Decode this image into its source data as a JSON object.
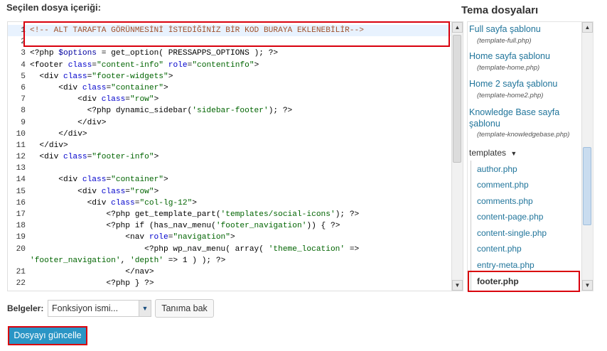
{
  "editor": {
    "heading": "Seçilen dosya içeriği:",
    "lines": [
      {
        "n": "1",
        "html": "<span class=\"cm\">&lt;!-- ALT TARAFTA GÖRÜNMESİNİ İSTEDİĞİNİZ BİR KOD BURAYA EKLENEBİLİR--&gt;</span>"
      },
      {
        "n": "2",
        "html": ""
      },
      {
        "n": "3",
        "html": "&lt;?php <span class=\"var\">$options</span> = get_option( PRESSAPPS_OPTIONS ); ?&gt;"
      },
      {
        "n": "4",
        "html": "&lt;footer <span class=\"at\">class</span>=<span class=\"st\">\"content-info\"</span> <span class=\"at\">role</span>=<span class=\"st\">\"contentinfo\"</span>&gt;"
      },
      {
        "n": "5",
        "html": "  &lt;div <span class=\"at\">class</span>=<span class=\"st\">\"footer-widgets\"</span>&gt;"
      },
      {
        "n": "6",
        "html": "      &lt;div <span class=\"at\">class</span>=<span class=\"st\">\"container\"</span>&gt;"
      },
      {
        "n": "7",
        "html": "          &lt;div <span class=\"at\">class</span>=<span class=\"st\">\"row\"</span>&gt;"
      },
      {
        "n": "8",
        "html": "            &lt;?php dynamic_sidebar(<span class=\"st\">'sidebar-footer'</span>); ?&gt;"
      },
      {
        "n": "9",
        "html": "          &lt;/div&gt;"
      },
      {
        "n": "10",
        "html": "      &lt;/div&gt;"
      },
      {
        "n": "11",
        "html": "  &lt;/div&gt;"
      },
      {
        "n": "12",
        "html": "  &lt;div <span class=\"at\">class</span>=<span class=\"st\">\"footer-info\"</span>&gt;"
      },
      {
        "n": "13",
        "html": ""
      },
      {
        "n": "14",
        "html": "      &lt;div <span class=\"at\">class</span>=<span class=\"st\">\"container\"</span>&gt;"
      },
      {
        "n": "15",
        "html": "          &lt;div <span class=\"at\">class</span>=<span class=\"st\">\"row\"</span>&gt;"
      },
      {
        "n": "16",
        "html": "            &lt;div <span class=\"at\">class</span>=<span class=\"st\">\"col-lg-12\"</span>&gt;"
      },
      {
        "n": "17",
        "html": "                &lt;?php get_template_part(<span class=\"st\">'templates/social-icons'</span>); ?&gt;"
      },
      {
        "n": "18",
        "html": "                &lt;?php if (has_nav_menu(<span class=\"st\">'footer_navigation'</span>)) { ?&gt;"
      },
      {
        "n": "19",
        "html": "                    &lt;nav <span class=\"at\">role</span>=<span class=\"st\">\"navigation\"</span>&gt;"
      },
      {
        "n": "20",
        "html": "                        &lt;?php wp_nav_menu( array( <span class=\"st\">'theme_location'</span> =&gt;",
        "wrap": "<span class=\"st\">'footer_navigation'</span>, <span class=\"st\">'depth'</span> =&gt; 1 ) ); ?&gt;"
      },
      {
        "n": "21",
        "html": "                    &lt;/nav&gt;"
      },
      {
        "n": "22",
        "html": "                &lt;?php } ?&gt;"
      }
    ],
    "scroll_position": 0.0
  },
  "sidebar": {
    "title": "Tema dosyaları",
    "templates": [
      {
        "name": "Full sayfa şablonu",
        "file": "(template-full.php)"
      },
      {
        "name": "Home sayfa şablonu",
        "file": "(template-home.php)"
      },
      {
        "name": "Home 2 sayfa şablonu",
        "file": "(template-home2.php)"
      },
      {
        "name": "Knowledge Base sayfa",
        "name2": "şablonu",
        "file": "(template-knowledgebase.php)"
      }
    ],
    "folder": "templates",
    "folder_arrow": "▼",
    "files": [
      "author.php",
      "comment.php",
      "comments.php",
      "content-page.php",
      "content-single.php",
      "content.php",
      "entry-meta.php",
      "footer.php"
    ],
    "selected_file": "footer.php"
  },
  "footer": {
    "docs_label": "Belgeler:",
    "select_value": "Fonksiyon ismi...",
    "lookup_button": "Tanıma bak",
    "update_button": "Dosyayı güncelle"
  },
  "colors": {
    "link": "#21759b",
    "highlight": "#d9000d",
    "primary_button": "#2a95c5"
  }
}
